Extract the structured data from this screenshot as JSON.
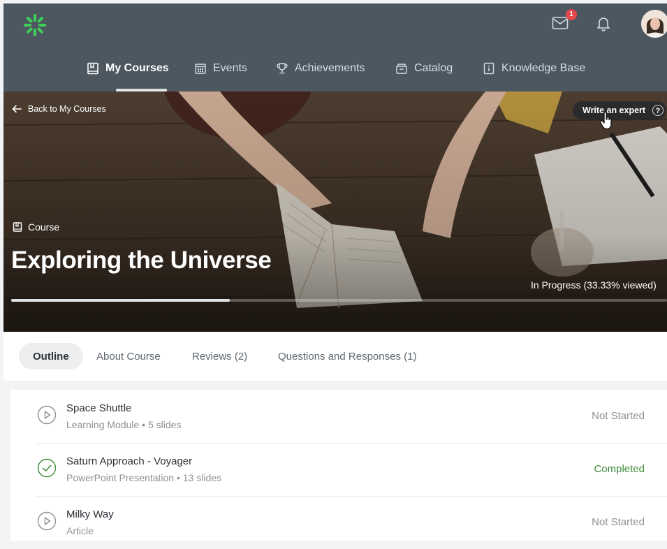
{
  "header": {
    "notification_count": "1",
    "nav": [
      {
        "label": "My Courses",
        "icon": "book-icon",
        "active": true
      },
      {
        "label": "Events",
        "icon": "calendar-icon",
        "active": false
      },
      {
        "label": "Achievements",
        "icon": "trophy-icon",
        "active": false
      },
      {
        "label": "Catalog",
        "icon": "archive-icon",
        "active": false
      },
      {
        "label": "Knowledge Base",
        "icon": "info-book-icon",
        "active": false
      }
    ]
  },
  "hero": {
    "back_label": "Back to My Courses",
    "write_expert_label": "Write an expert",
    "help_label": "?",
    "kicker": "Course",
    "title": "Exploring the Universe",
    "progress_label": "In Progress (33.33% viewed)",
    "progress_fraction": 0.3333
  },
  "tabs": [
    {
      "label": "Outline",
      "active": true
    },
    {
      "label": "About Course",
      "active": false
    },
    {
      "label": "Reviews (2)",
      "active": false
    },
    {
      "label": "Questions and Responses (1)",
      "active": false
    }
  ],
  "outline": [
    {
      "title": "Space Shuttle",
      "meta": "Learning Module  •  5 slides",
      "status": "Not Started",
      "icon": "play-circle-icon"
    },
    {
      "title": "Saturn Approach - Voyager",
      "meta": "PowerPoint Presentation  •  13 slides",
      "status": "Completed",
      "icon": "check-circle-icon"
    },
    {
      "title": "Milky Way",
      "meta": "Article",
      "status": "Not Started",
      "icon": "play-circle-icon"
    }
  ],
  "colors": {
    "topbar": "#4c5760",
    "logo_green": "#3fcf58",
    "badge_red": "#e5454b",
    "completed_green": "#3f8a3a"
  }
}
